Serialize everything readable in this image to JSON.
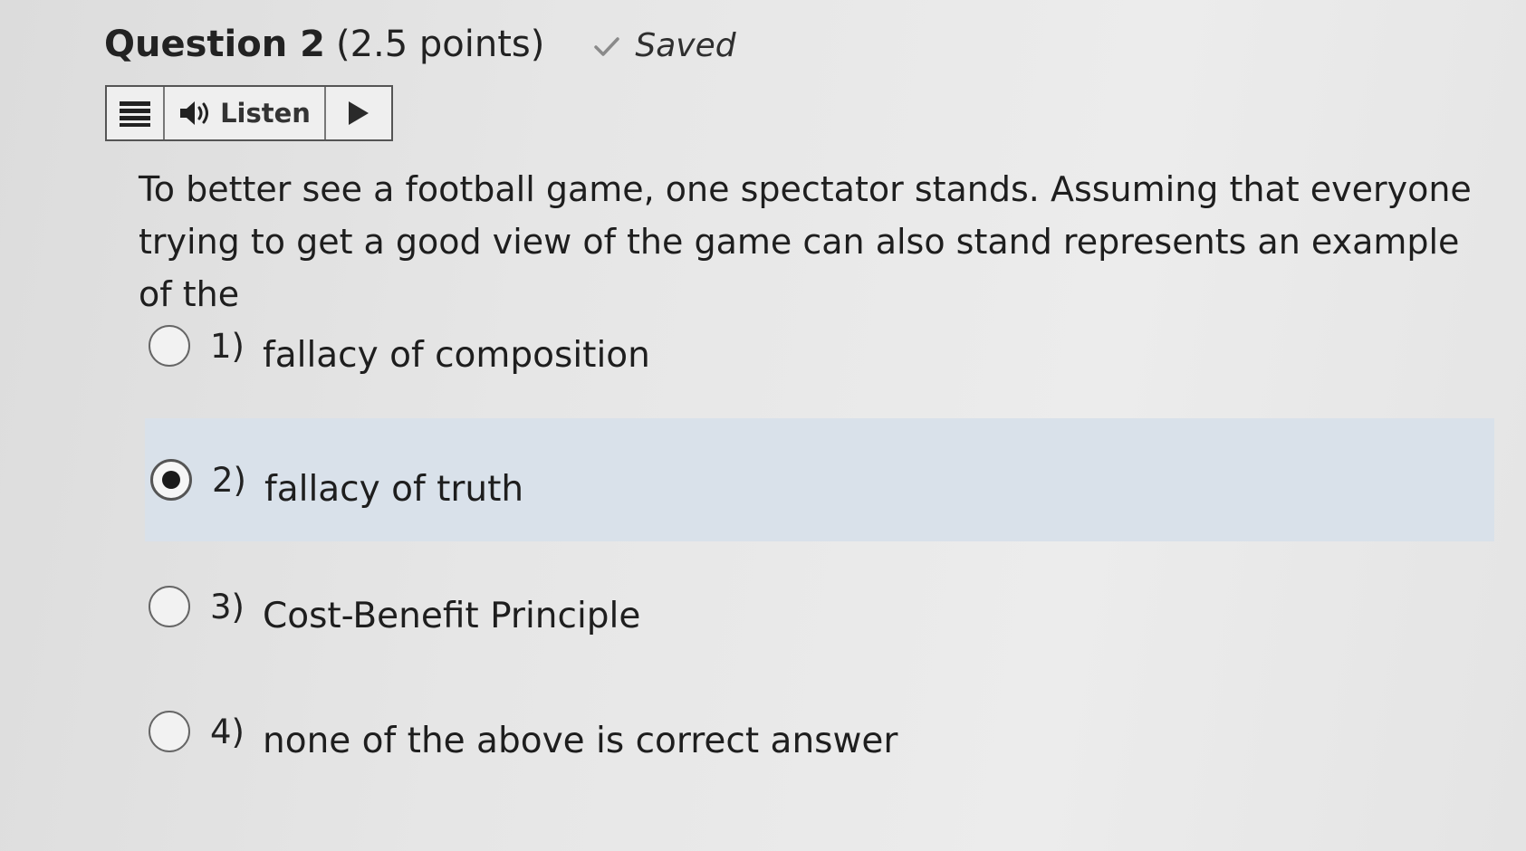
{
  "question": {
    "title": "Question 2",
    "points": "(2.5 points)",
    "status": "Saved",
    "status_icon": "checkmark-icon",
    "text": "To better see a football game, one spectator stands. Assuming that everyone trying to get a good view of the game can also stand represents an example of the"
  },
  "toolbar": {
    "menu_icon": "menu-icon",
    "listen_icon": "speaker-icon",
    "listen_label": "Listen",
    "play_icon": "play-icon"
  },
  "options": [
    {
      "number": "1)",
      "label": "fallacy of composition",
      "selected": false
    },
    {
      "number": "2)",
      "label": "fallacy of truth",
      "selected": true
    },
    {
      "number": "3)",
      "label": "Cost-Benefit Principle",
      "selected": false
    },
    {
      "number": "4)",
      "label": "none of the above is correct answer",
      "selected": false
    }
  ],
  "colors": {
    "selected_row": "#d9e1ea",
    "play_arrow": "#2a2a2a"
  }
}
